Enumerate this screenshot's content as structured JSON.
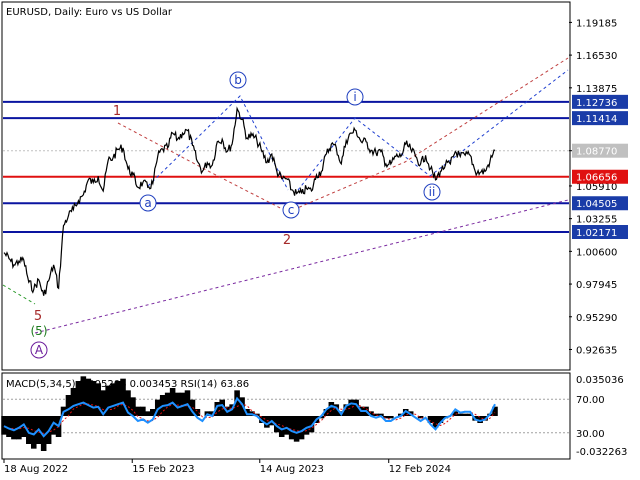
{
  "header": {
    "title": "EURUSD, Daily:  Euro vs US Dollar",
    "indicator_title": "MACD(5,34,5) 0.005204 0.003453 RSI(14) 63.86"
  },
  "colors": {
    "price_line": "#000000",
    "level_blue": "#0a14a0",
    "level_red": "#e01010",
    "level_box_blue": "#1a3ca8",
    "level_box_red": "#e01010",
    "current_box": "#c0c0c0",
    "trend_red": "#c04040",
    "trend_blue": "#2040d0",
    "trend_purple": "#7a2aa0",
    "macd_hist": "#000000",
    "rsi_line": "#1e90ff",
    "signal_line": "#e01010"
  },
  "chart_data": [
    {
      "type": "line",
      "title": "EURUSD, Daily:  Euro vs US Dollar",
      "x_tick_labels": [
        "18 Aug 2022",
        "15 Feb 2023",
        "14 Aug 2023",
        "12 Feb 2024"
      ],
      "y_tick_labels": [
        "1.19185",
        "1.16530",
        "1.13875",
        "1.08770",
        "1.05910",
        "1.03255",
        "1.00600",
        "0.97945",
        "0.95290",
        "0.92635"
      ],
      "ylim": [
        0.9105,
        1.2076
      ],
      "grid": false,
      "price_levels": [
        {
          "value": 1.12736,
          "label": "1.12736",
          "color": "blue"
        },
        {
          "value": 1.11414,
          "label": "1.11414",
          "color": "blue"
        },
        {
          "value": 1.06656,
          "label": "1.06656",
          "color": "red"
        },
        {
          "value": 1.04505,
          "label": "1.04505",
          "color": "blue"
        },
        {
          "value": 1.02171,
          "label": "1.02171",
          "color": "blue"
        }
      ],
      "current_price": {
        "value": 1.0877,
        "label": "1.08770"
      },
      "series": [
        {
          "x": [
            "2022-08-18",
            "2022-08-25",
            "2022-09-01",
            "2022-09-08",
            "2022-09-15",
            "2022-09-22",
            "2022-09-29",
            "2022-10-06",
            "2022-10-13",
            "2022-10-20",
            "2022-10-27",
            "2022-11-03",
            "2022-11-10",
            "2022-11-17",
            "2022-11-24",
            "2022-12-01",
            "2022-12-08",
            "2022-12-15",
            "2022-12-22",
            "2022-12-29",
            "2023-01-05",
            "2023-01-12",
            "2023-01-19",
            "2023-01-26",
            "2023-02-02",
            "2023-02-09",
            "2023-02-16",
            "2023-02-23",
            "2023-03-02",
            "2023-03-09",
            "2023-03-16",
            "2023-03-23",
            "2023-03-30",
            "2023-04-06",
            "2023-04-13",
            "2023-04-20",
            "2023-04-27",
            "2023-05-04",
            "2023-05-11",
            "2023-05-18",
            "2023-05-25",
            "2023-06-01",
            "2023-06-08",
            "2023-06-15",
            "2023-06-22",
            "2023-06-29",
            "2023-07-06",
            "2023-07-13",
            "2023-07-20",
            "2023-07-27",
            "2023-08-03",
            "2023-08-10",
            "2023-08-17",
            "2023-08-24",
            "2023-08-31",
            "2023-09-07",
            "2023-09-14",
            "2023-09-21",
            "2023-09-28",
            "2023-10-05",
            "2023-10-12",
            "2023-10-19",
            "2023-10-26",
            "2023-11-02",
            "2023-11-09",
            "2023-11-16",
            "2023-11-23",
            "2023-11-30",
            "2023-12-07",
            "2023-12-14",
            "2023-12-21",
            "2023-12-28",
            "2024-01-04",
            "2024-01-11",
            "2024-01-18",
            "2024-01-25",
            "2024-02-01",
            "2024-02-08",
            "2024-02-15",
            "2024-02-22",
            "2024-02-29",
            "2024-03-07",
            "2024-03-14",
            "2024-03-21",
            "2024-03-28",
            "2024-04-04",
            "2024-04-11",
            "2024-04-18",
            "2024-04-25",
            "2024-05-02",
            "2024-05-09",
            "2024-05-16",
            "2024-05-23",
            "2024-05-30",
            "2024-06-06",
            "2024-06-13",
            "2024-06-20",
            "2024-06-27",
            "2024-07-04",
            "2024-07-11"
          ],
          "values": [
            1.005,
            1.0,
            0.995,
            0.998,
            0.999,
            0.981,
            0.975,
            0.983,
            0.97,
            0.982,
            0.995,
            0.976,
            1.027,
            1.035,
            1.04,
            1.047,
            1.052,
            1.064,
            1.062,
            1.067,
            1.055,
            1.08,
            1.082,
            1.089,
            1.09,
            1.073,
            1.068,
            1.058,
            1.062,
            1.058,
            1.061,
            1.083,
            1.089,
            1.09,
            1.102,
            1.097,
            1.102,
            1.104,
            1.092,
            1.079,
            1.071,
            1.078,
            1.076,
            1.095,
            1.097,
            1.087,
            1.093,
            1.122,
            1.113,
            1.098,
            1.1,
            1.096,
            1.087,
            1.078,
            1.085,
            1.071,
            1.065,
            1.065,
            1.056,
            1.053,
            1.053,
            1.057,
            1.055,
            1.068,
            1.071,
            1.085,
            1.093,
            1.09,
            1.077,
            1.096,
            1.102,
            1.104,
            1.095,
            1.095,
            1.088,
            1.086,
            1.087,
            1.077,
            1.077,
            1.083,
            1.083,
            1.093,
            1.089,
            1.083,
            1.077,
            1.084,
            1.073,
            1.064,
            1.071,
            1.076,
            1.077,
            1.087,
            1.083,
            1.084,
            1.084,
            1.071,
            1.07,
            1.071,
            1.079,
            1.088
          ]
        }
      ],
      "wave_labels": [
        {
          "text": "1",
          "style": "red"
        },
        {
          "text": "2",
          "style": "red"
        },
        {
          "text": "5",
          "style": "red"
        },
        {
          "text": "(5)",
          "style": "green"
        },
        {
          "text": "A",
          "style": "purple-circle"
        },
        {
          "text": "a",
          "style": "blue-circle"
        },
        {
          "text": "b",
          "style": "blue-circle"
        },
        {
          "text": "c",
          "style": "blue-circle"
        },
        {
          "text": "i",
          "style": "blue-circle"
        },
        {
          "text": "ii",
          "style": "blue-circle"
        }
      ]
    },
    {
      "type": "line",
      "title": "MACD(5,34,5) 0.005204 0.003453 RSI(14) 63.86",
      "y_tick_labels": [
        "0.035036",
        "70.00",
        "30.00",
        "-0.032263"
      ],
      "ylim": [
        0,
        100
      ],
      "reference_levels": [
        70,
        30
      ],
      "series": [
        {
          "name": "RSI(14)",
          "values": [
            38,
            35,
            33,
            36,
            40,
            30,
            28,
            34,
            26,
            32,
            42,
            38,
            55,
            58,
            62,
            64,
            66,
            63,
            60,
            61,
            52,
            60,
            62,
            64,
            66,
            54,
            50,
            44,
            46,
            42,
            46,
            58,
            62,
            63,
            66,
            60,
            62,
            64,
            55,
            48,
            44,
            52,
            50,
            62,
            63,
            55,
            58,
            71,
            64,
            52,
            52,
            50,
            44,
            40,
            44,
            38,
            34,
            36,
            32,
            30,
            32,
            36,
            38,
            46,
            50,
            58,
            62,
            60,
            52,
            62,
            65,
            64,
            56,
            56,
            50,
            48,
            50,
            44,
            44,
            48,
            50,
            56,
            52,
            48,
            44,
            48,
            40,
            34,
            42,
            48,
            50,
            58,
            54,
            55,
            55,
            46,
            44,
            46,
            52,
            64
          ]
        },
        {
          "name": "MACD histogram",
          "values": [
            -8,
            -9,
            -10,
            -10,
            -9,
            -12,
            -14,
            -12,
            -15,
            -12,
            -8,
            -9,
            4,
            9,
            12,
            15,
            17,
            16,
            15,
            14,
            11,
            13,
            14,
            15,
            16,
            11,
            8,
            4,
            4,
            2,
            3,
            7,
            9,
            10,
            12,
            10,
            10,
            11,
            7,
            3,
            0,
            2,
            2,
            6,
            7,
            4,
            5,
            11,
            8,
            3,
            2,
            1,
            -3,
            -5,
            -4,
            -7,
            -9,
            -8,
            -10,
            -11,
            -10,
            -8,
            -7,
            -3,
            -1,
            3,
            6,
            5,
            2,
            5,
            7,
            7,
            4,
            4,
            2,
            1,
            1,
            -1,
            -1,
            0,
            1,
            3,
            2,
            0,
            -1,
            0,
            -3,
            -5,
            -3,
            -1,
            0,
            2,
            1,
            1,
            1,
            -2,
            -3,
            -2,
            1,
            4
          ]
        }
      ]
    }
  ]
}
